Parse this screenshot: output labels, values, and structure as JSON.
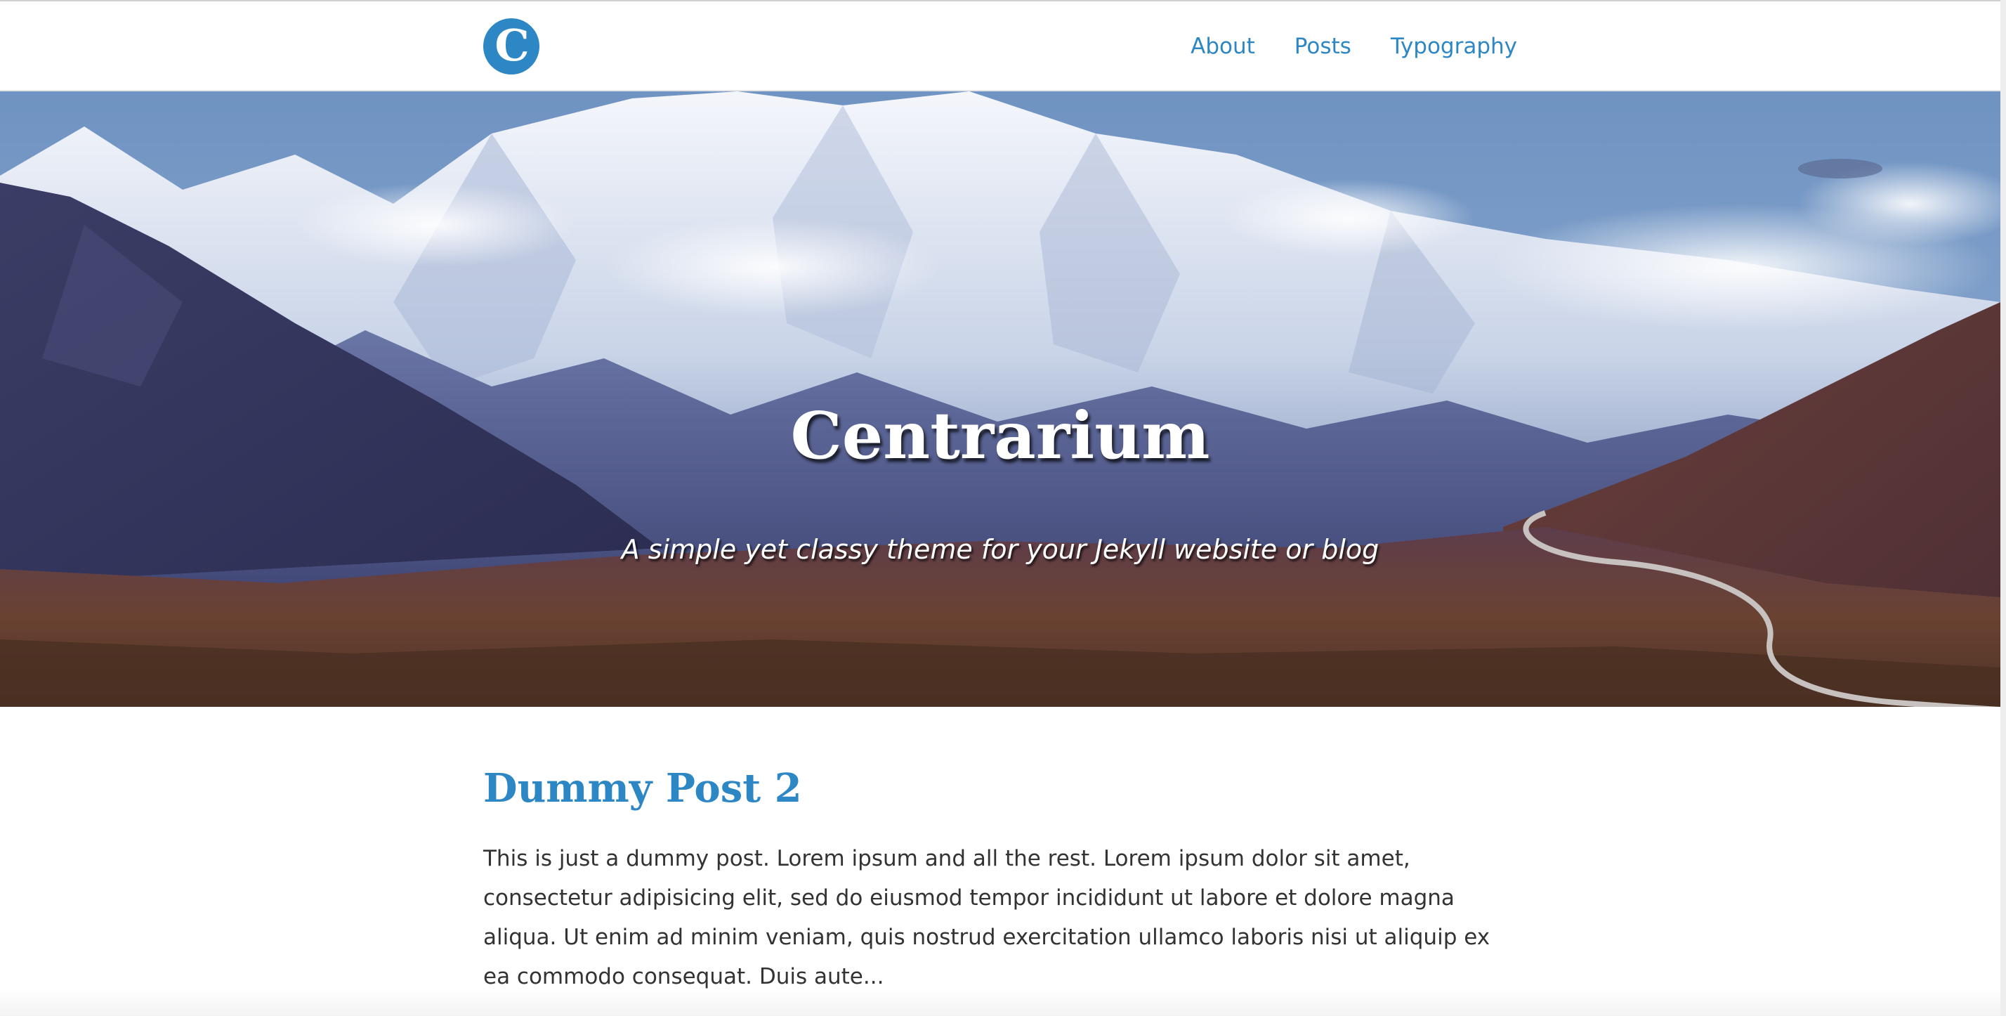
{
  "site": {
    "logo_letter": "C",
    "brand_color": "#2c87c4"
  },
  "nav": {
    "items": [
      {
        "label": "About"
      },
      {
        "label": "Posts"
      },
      {
        "label": "Typography"
      }
    ]
  },
  "hero": {
    "title": "Centrarium",
    "subtitle": "A simple yet classy theme for your Jekyll website or blog"
  },
  "posts": [
    {
      "title": "Dummy Post 2",
      "excerpt": "This is just a dummy post. Lorem ipsum and all the rest. Lorem ipsum dolor sit amet, consectetur adipisicing elit, sed do eiusmod tempor incididunt ut labore et dolore magna aliqua. Ut enim ad minim veniam, quis nostrud exercitation ullamco laboris nisi ut aliquip ex ea commodo consequat. Duis aute..."
    }
  ]
}
